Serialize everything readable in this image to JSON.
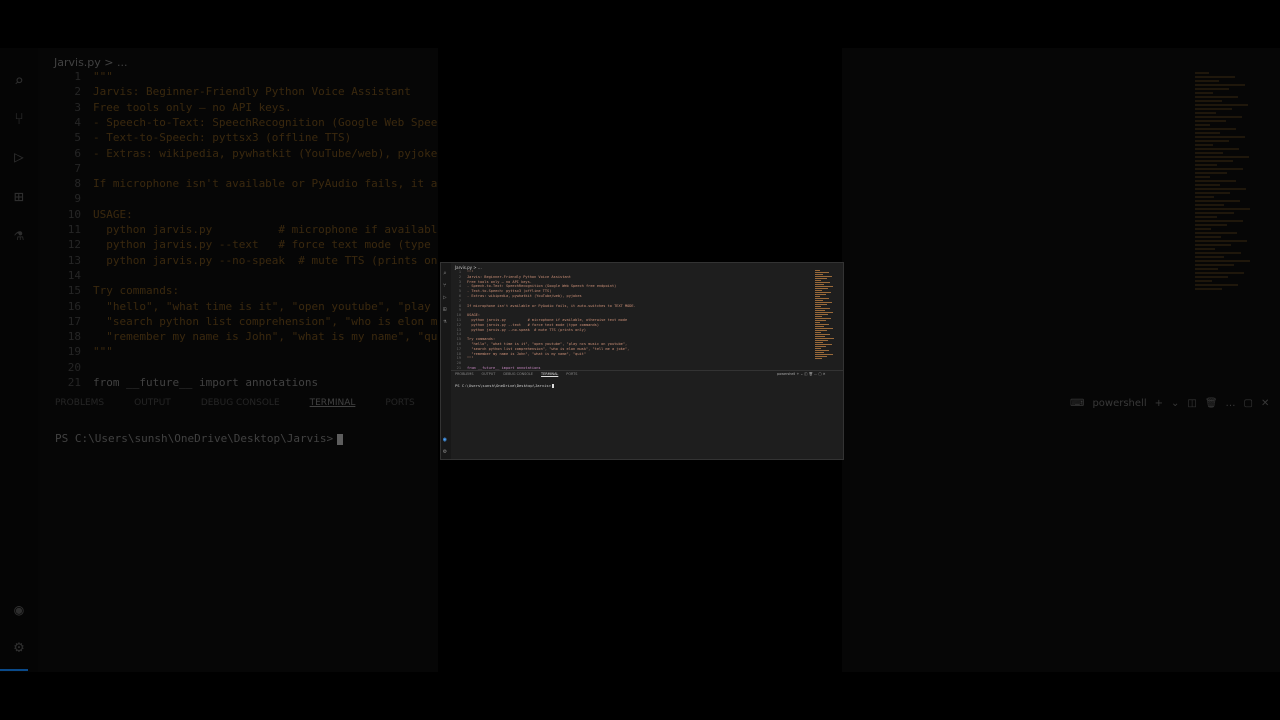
{
  "file_tab": "Jarvis.py > ...",
  "code_lines": [
    {
      "n": "1",
      "t": "\"\"\"",
      "c": "s"
    },
    {
      "n": "2",
      "t": "Jarvis: Beginner-Friendly Python Voice Assistant",
      "c": "s"
    },
    {
      "n": "3",
      "t": "Free tools only — no API keys.",
      "c": "s"
    },
    {
      "n": "4",
      "t": "- Speech-to-Text: SpeechRecognition (Google Web Speech free endpoint)",
      "c": "s"
    },
    {
      "n": "5",
      "t": "- Text-to-Speech: pyttsx3 (offline TTS)",
      "c": "s"
    },
    {
      "n": "6",
      "t": "- Extras: wikipedia, pywhatkit (YouTube/web), pyjokes",
      "c": "s"
    },
    {
      "n": "7",
      "t": "",
      "c": "s"
    },
    {
      "n": "8",
      "t": "If microphone isn't available or PyAudio fails, it auto-switches to TEXT MODE.",
      "c": "s"
    },
    {
      "n": "9",
      "t": "",
      "c": "s"
    },
    {
      "n": "10",
      "t": "USAGE:",
      "c": "s"
    },
    {
      "n": "11",
      "t": "  python jarvis.py          # microphone if available, otherwise text mode",
      "c": "s"
    },
    {
      "n": "12",
      "t": "  python jarvis.py --text   # force text mode (type commands)",
      "c": "s"
    },
    {
      "n": "13",
      "t": "  python jarvis.py --no-speak  # mute TTS (prints only)",
      "c": "s"
    },
    {
      "n": "14",
      "t": "",
      "c": "s"
    },
    {
      "n": "15",
      "t": "Try commands:",
      "c": "s"
    },
    {
      "n": "16",
      "t": "  \"hello\", \"what time is it\", \"open youtube\", \"play ncs music on youtube\",",
      "c": "s"
    },
    {
      "n": "17",
      "t": "  \"search python list comprehension\", \"who is elon musk\", \"tell me a joke\",",
      "c": "s"
    },
    {
      "n": "18",
      "t": "  \"remember my name is John\", \"what is my name\", \"quit\"",
      "c": "s"
    },
    {
      "n": "19",
      "t": "\"\"\"",
      "c": "s"
    },
    {
      "n": "20",
      "t": "",
      "c": "s"
    },
    {
      "n": "21",
      "t": "from __future__ import annotations",
      "c": "k"
    }
  ],
  "panel_tabs": [
    "PROBLEMS",
    "OUTPUT",
    "DEBUG CONSOLE",
    "TERMINAL",
    "PORTS"
  ],
  "active_panel_tab": "TERMINAL",
  "terminal_prompt": "PS C:\\Users\\sunsh\\OneDrive\\Desktop\\Jarvis>",
  "terminal_shell": "powershell",
  "activity_icons": [
    "explorer-icon",
    "search-icon",
    "source-control-icon",
    "run-debug-icon",
    "extensions-icon",
    "testing-icon"
  ],
  "colors": {
    "string": "#ce9178",
    "keyword": "#c586c0",
    "accent": "#4aa3ff"
  }
}
